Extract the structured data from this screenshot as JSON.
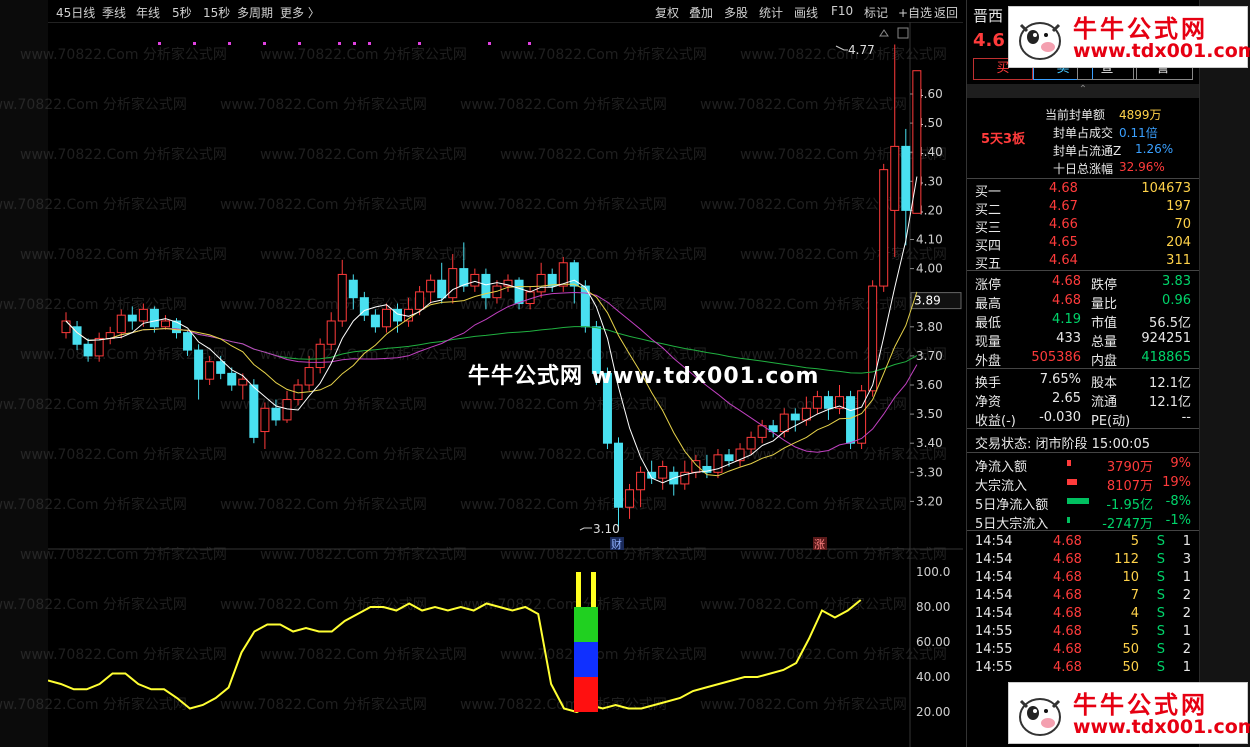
{
  "toolbar": {
    "left_items": [
      "45日线",
      "季线",
      "年线",
      "5秒",
      "15秒",
      "多周期",
      "更多 〉"
    ],
    "right_items": [
      "复权",
      "叠加",
      "多股",
      "统计",
      "画线",
      "F10",
      "标记",
      "+自选",
      "返回"
    ]
  },
  "stock": {
    "name_partial": "晋西",
    "price_partial": "4.6",
    "buttons": [
      "买",
      "卖",
      "查",
      "警"
    ],
    "limit_streak": "5天3板",
    "seal_label": "当前封单额",
    "seal_value": "4899万",
    "seal_turnover_label": "封单占成交",
    "seal_turnover_value": "0.11倍",
    "seal_float_label": "封单占流通Z",
    "seal_float_value": "1.26%",
    "ten_day_label": "十日总涨幅",
    "ten_day_value": "32.96%"
  },
  "order_book": [
    {
      "label": "买一",
      "price": "4.68",
      "vol": "104673"
    },
    {
      "label": "买二",
      "price": "4.67",
      "vol": "197"
    },
    {
      "label": "买三",
      "price": "4.66",
      "vol": "70"
    },
    {
      "label": "买四",
      "price": "4.65",
      "vol": "204"
    },
    {
      "label": "买五",
      "price": "4.64",
      "vol": "311"
    }
  ],
  "quote": {
    "limit_up_label": "涨停",
    "limit_up": "4.68",
    "limit_down_label": "跌停",
    "limit_down": "3.83",
    "high_label": "最高",
    "high": "4.68",
    "vol_ratio_label": "量比",
    "vol_ratio": "0.96",
    "low_label": "最低",
    "low": "4.19",
    "mktcap_label": "市值",
    "mktcap": "56.5亿",
    "now_vol_label": "现量",
    "now_vol": "433",
    "total_vol_label": "总量",
    "total_vol": "924251",
    "outer_label": "外盘",
    "outer": "505386",
    "inner_label": "内盘",
    "inner": "418865",
    "turnover_label": "换手",
    "turnover": "7.65%",
    "share_cap_label": "股本",
    "share_cap": "12.1亿",
    "nav_label": "净资",
    "nav": "2.65",
    "float_label": "流通",
    "float": "12.1亿",
    "eps_label": "收益(-)",
    "eps": "-0.030",
    "pe_label": "PE(动)",
    "pe": "--"
  },
  "trade_status": "交易状态: 闭市阶段 15:00:05",
  "flows": [
    {
      "label": "净流入额",
      "value": "3790万",
      "pct": "9%",
      "color": "red"
    },
    {
      "label": "大宗流入",
      "value": "8107万",
      "pct": "19%",
      "color": "red"
    },
    {
      "label": "5日净流入额",
      "value": "-1.95亿",
      "pct": "-8%",
      "color": "green"
    },
    {
      "label": "5日大宗流入",
      "value": "-2747万",
      "pct": "-1%",
      "color": "green"
    }
  ],
  "ticks": [
    {
      "time": "14:54",
      "price": "4.68",
      "vol": "5",
      "side": "S",
      "n": "1"
    },
    {
      "time": "14:54",
      "price": "4.68",
      "vol": "112",
      "side": "S",
      "n": "3"
    },
    {
      "time": "14:54",
      "price": "4.68",
      "vol": "10",
      "side": "S",
      "n": "1"
    },
    {
      "time": "14:54",
      "price": "4.68",
      "vol": "7",
      "side": "S",
      "n": "2"
    },
    {
      "time": "14:54",
      "price": "4.68",
      "vol": "4",
      "side": "S",
      "n": "2"
    },
    {
      "time": "14:55",
      "price": "4.68",
      "vol": "5",
      "side": "S",
      "n": "1"
    },
    {
      "time": "14:55",
      "price": "4.68",
      "vol": "50",
      "side": "S",
      "n": "2"
    },
    {
      "time": "14:55",
      "price": "4.68",
      "vol": "50",
      "side": "S",
      "n": "1"
    }
  ],
  "chart": {
    "price_axis": [
      "4.60",
      "4.50",
      "4.40",
      "4.30",
      "4.20",
      "4.10",
      "4.00",
      "3.90",
      "3.80",
      "3.70",
      "3.60",
      "3.50",
      "3.40",
      "3.30",
      "3.20"
    ],
    "indicator_axis": [
      "100.0",
      "80.00",
      "60.00",
      "40.00",
      "20.00"
    ],
    "current_price_tag": "3.89",
    "high_mark": "4.77",
    "low_mark": "3.10",
    "event_finance": "财",
    "event_limit": "涨"
  },
  "watermark": {
    "center": "牛牛公式网 www.tdx001.com",
    "tile": "www.70822.Com 分析家公式网",
    "logo_title": "牛牛公式网",
    "logo_url": "www.tdx001.com"
  },
  "colors": {
    "up": "#ff3b3b",
    "down": "#49e0f0",
    "ma5": "#ffffff",
    "ma10": "#e6d24a",
    "ma20": "#c040c0",
    "ma60": "#20b040",
    "osc": "#ffff33"
  }
}
